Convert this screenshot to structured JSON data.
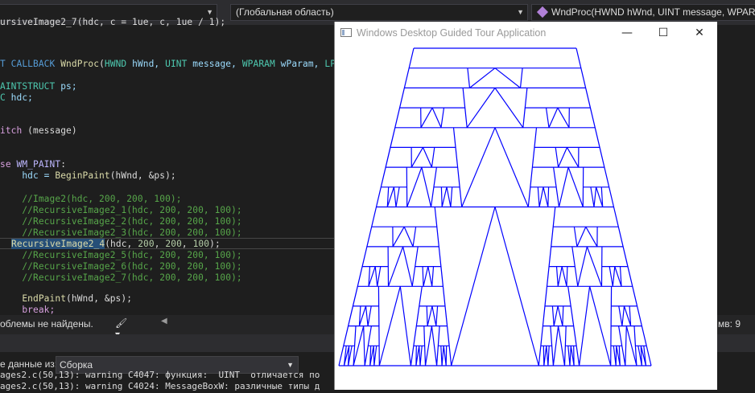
{
  "ide": {
    "nav": {
      "scope_label": "(Глобальная область)",
      "function_label": "WndProc(HWND hWnd, UINT message, WPARAM"
    },
    "code": {
      "l1": "ursiveImage2_7(hdc, c = 1ue, c, 1ue / 1);",
      "l2a": "T CALLBACK ",
      "l2b": "WndProc",
      "l2c": "(",
      "l2d": "HWND",
      "l2e": " hWnd, ",
      "l2f": "UINT",
      "l2g": " message, ",
      "l2h": "WPARAM",
      "l2i": " wParam, ",
      "l2j": "LPARAM",
      "l3a": "AINTSTRUCT",
      "l3b": " ps;",
      "l4a": "C",
      "l4b": " hdc;",
      "l5a": "itch",
      "l5b": " (message)",
      "l6a": "se",
      "l6b": " WM_PAINT",
      "l6c": ":",
      "l7a": "    hdc = ",
      "l7b": "BeginPaint",
      "l7c": "(hWnd, &ps);",
      "c1": "    //Image2(hdc, 200, 200, 100);",
      "c2": "    //RecursiveImage2_1(hdc, 200, 200, 100);",
      "c3": "    //RecursiveImage2_2(hdc, 200, 200, 100);",
      "c4": "    //RecursiveImage2_3(hdc, 200, 200, 100);",
      "cur_fn": "RecursiveImage2_4",
      "cur_args": "(hdc, ",
      "n1": "200",
      "n2": "200",
      "n3": "100",
      "cur_end": ");",
      "c5": "    //RecursiveImage2_5(hdc, 200, 200, 100);",
      "c6": "    //RecursiveImage2_6(hdc, 200, 200, 100);",
      "c7": "    //RecursiveImage2_7(hdc, 200, 200, 100);",
      "l8a": "    ",
      "l8b": "EndPaint",
      "l8c": "(hWnd, &ps);",
      "l9": "    break;"
    },
    "status": {
      "problems": "облемы не найдены.",
      "column": "мв: 9"
    },
    "output": {
      "label": "е данные из:",
      "source": "Сборка",
      "line1": "ages2.c(50,13): warning C4047: функция:  UINT  отличается по",
      "line2": "ages2.c(50,13): warning C4024: MessageBoxW: различные типы д"
    }
  },
  "app_window": {
    "title": "Windows Desktop Guided Tour Application",
    "minimize_glyph": "—",
    "maximize_glyph": "☐",
    "close_glyph": "✕"
  },
  "fractal": {
    "stroke_color": "#0000ff",
    "depth": 4
  }
}
